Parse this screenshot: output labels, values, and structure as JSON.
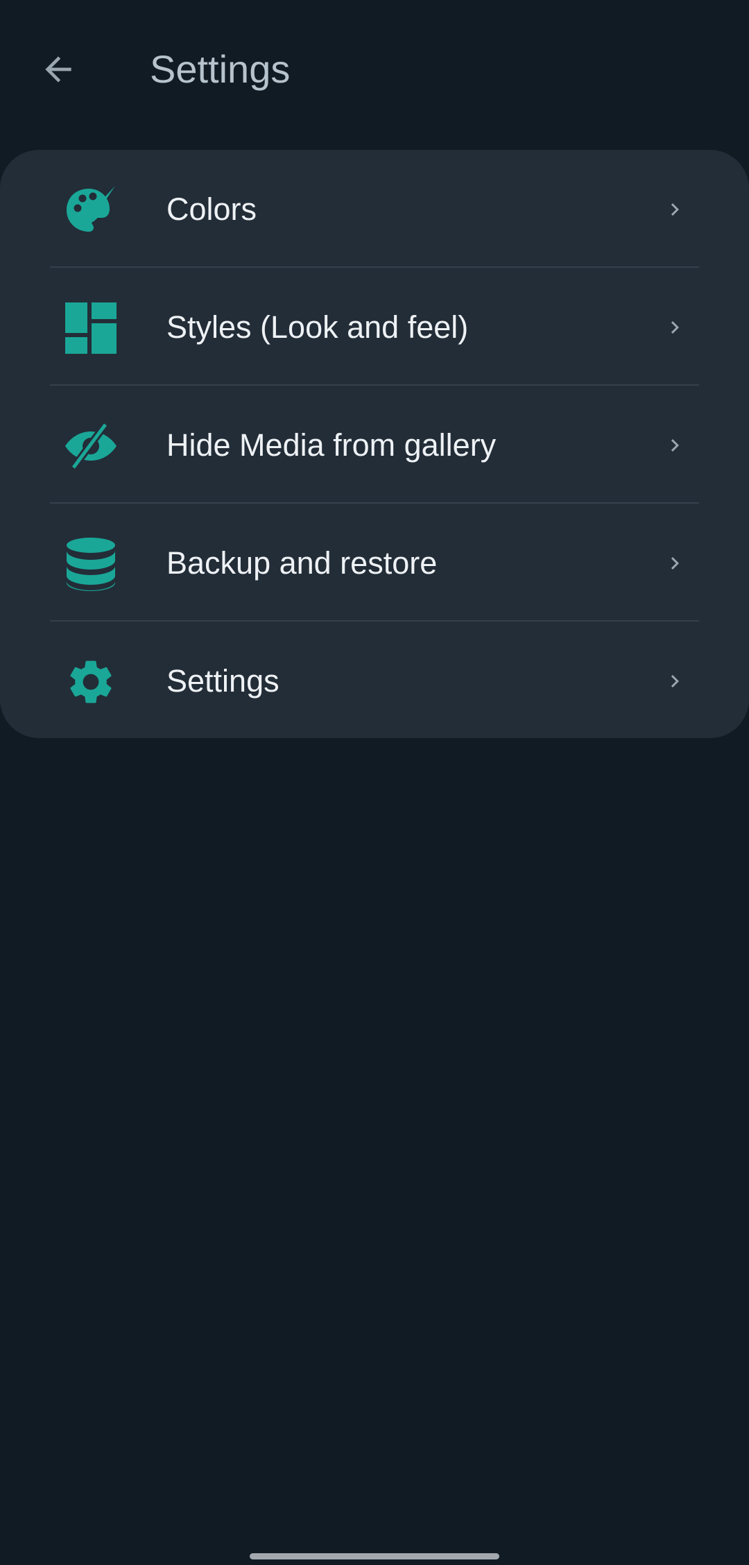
{
  "header": {
    "back_icon": "arrow-back-icon",
    "title": "Settings"
  },
  "menu": {
    "items": [
      {
        "id": "colors",
        "label": "Colors",
        "icon": "palette-icon"
      },
      {
        "id": "styles",
        "label": "Styles (Look and feel)",
        "icon": "dashboard-icon"
      },
      {
        "id": "hide-media",
        "label": "Hide Media from gallery",
        "icon": "eye-off-icon"
      },
      {
        "id": "backup",
        "label": "Backup and restore",
        "icon": "database-icon"
      },
      {
        "id": "settings",
        "label": "Settings",
        "icon": "gear-icon"
      }
    ]
  },
  "colors": {
    "background": "#101b24",
    "card": "#232d38",
    "accent": "#1aa797",
    "text_primary": "#eef2f5",
    "text_secondary": "#b6c2cc",
    "chevron": "#9aa6b0",
    "divider": "#34404b"
  }
}
